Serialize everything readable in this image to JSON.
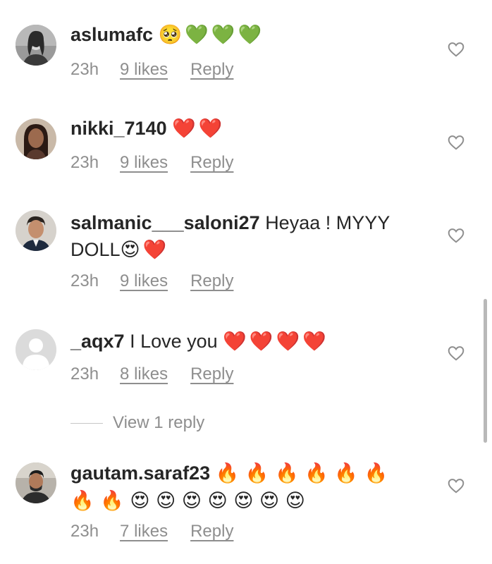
{
  "comments": [
    {
      "username": "aslumafc",
      "text": "",
      "emojis": [
        {
          "glyph": "🥺",
          "color": "#f4b400"
        },
        {
          "glyph": "💚",
          "color": "#2fbf3a"
        },
        {
          "glyph": "💚",
          "color": "#2fbf3a"
        },
        {
          "glyph": "💚",
          "color": "#2fbf3a"
        }
      ],
      "time": "23h",
      "likes": "9 likes",
      "reply": "Reply",
      "avatar_icon": "woman-portrait-avatar"
    },
    {
      "username": "nikki_7140",
      "text": "",
      "emojis": [
        {
          "glyph": "❤️",
          "color": "#e8212c"
        },
        {
          "glyph": "❤️",
          "color": "#e8212c"
        }
      ],
      "time": "23h",
      "likes": "9 likes",
      "reply": "Reply",
      "avatar_icon": "woman-portrait-avatar"
    },
    {
      "username": "salmanic___saloni27",
      "text": "Heyaa ! MYYY DOLL",
      "emojis": [
        {
          "glyph": "😍",
          "color": "#f4b400"
        },
        {
          "glyph": "❤️",
          "color": "#e8212c"
        }
      ],
      "time": "23h",
      "likes": "9 likes",
      "reply": "Reply",
      "avatar_icon": "man-portrait-avatar"
    },
    {
      "username": "_aqx7",
      "text": "I Love you",
      "emojis": [
        {
          "glyph": "❤️",
          "color": "#e8212c"
        },
        {
          "glyph": "❤️",
          "color": "#e8212c"
        },
        {
          "glyph": "❤️",
          "color": "#e8212c"
        },
        {
          "glyph": "❤️",
          "color": "#e8212c"
        }
      ],
      "time": "23h",
      "likes": "8 likes",
      "reply": "Reply",
      "avatar_icon": "default-user-avatar"
    },
    {
      "username": "gautam.saraf23",
      "text": "",
      "emojis_line1": "🔥 🔥 🔥 🔥 🔥 🔥",
      "emojis_line2": "🔥 🔥 😍 😍 😍 😍 😍 😍 😍",
      "time": "23h",
      "likes": "7 likes",
      "reply": "Reply",
      "avatar_icon": "man-portrait-avatar"
    }
  ],
  "view_replies": "View 1 reply",
  "colors": {
    "text": "#262626",
    "secondary": "#8e8e8e",
    "heart_red": "#e8212c",
    "heart_green": "#2fbf3a"
  },
  "icons": {
    "like": "heart-outline-icon",
    "scroll": "scrollbar-thumb"
  }
}
